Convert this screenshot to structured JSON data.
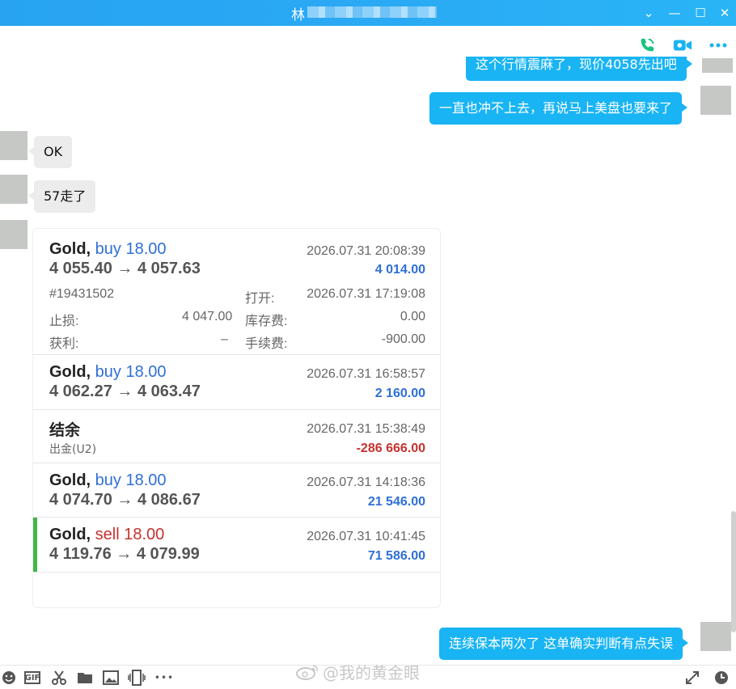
{
  "window": {
    "title": "林",
    "minimize": "—",
    "maximize": "☐",
    "close": "✕",
    "collapse": "⌄"
  },
  "header_icons": [
    "phone-icon",
    "video-call-icon",
    "more-icon"
  ],
  "messages": {
    "m1": "这个行情震麻了，现价4058先出吧",
    "m2": "一直也冲不上去，再说马上美盘也要来了",
    "m3": "OK",
    "m4": "57走了",
    "m5": "连续保本两次了 这单确实判断有点失误"
  },
  "trades": [
    {
      "symbol": "Gold,",
      "action": "buy 18.00",
      "side": "buy",
      "prices": "4 055.40 → 4 057.63",
      "time": "2026.07.31 20:08:39",
      "profit": "4 014.00",
      "ticket": "#19431502",
      "open_label": "打开:",
      "open_time": "2026.07.31 17:19:08",
      "sl_label": "止损:",
      "sl_value": "4 047.00",
      "swap_label": "库存费:",
      "swap_value": "0.00",
      "tp_label": "获利:",
      "tp_value": "–",
      "fee_label": "手续费:",
      "fee_value": "-900.00"
    },
    {
      "symbol": "Gold,",
      "action": "buy 18.00",
      "side": "buy",
      "prices": "4 062.27 → 4 063.47",
      "time": "2026.07.31 16:58:57",
      "profit": "2 160.00"
    },
    {
      "symbol": "结余",
      "subtitle": "出金(U2)",
      "time": "2026.07.31 15:38:49",
      "profit": "-286 666.00"
    },
    {
      "symbol": "Gold,",
      "action": "buy 18.00",
      "side": "buy",
      "prices": "4 074.70 → 4 086.67",
      "time": "2026.07.31 14:18:36",
      "profit": "21 546.00"
    },
    {
      "symbol": "Gold,",
      "action": "sell 18.00",
      "side": "sell",
      "prices": "4 119.76 → 4 079.99",
      "time": "2026.07.31 10:41:45",
      "profit": "71 586.00"
    }
  ],
  "toolbar": {
    "gif": "GIF",
    "more": "•••"
  },
  "watermark": "@我的黄金眼",
  "colors": {
    "accent": "#19b4f3",
    "buy": "#2f6fd6",
    "sell": "#c5322d",
    "sell_marker": "#43b649"
  }
}
